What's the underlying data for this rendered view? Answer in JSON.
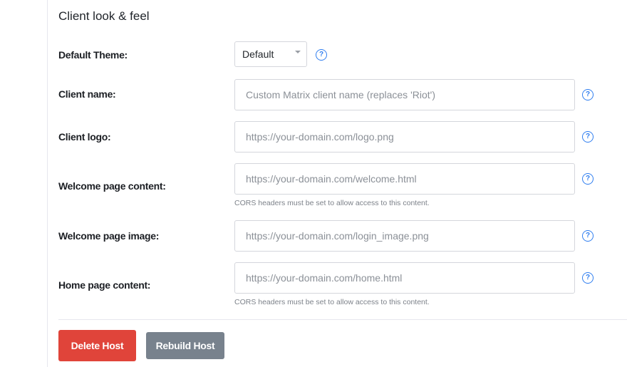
{
  "section": {
    "title": "Client look & feel"
  },
  "fields": {
    "theme": {
      "label": "Default Theme:",
      "selected": "Default",
      "help_icon": "question-circle-icon"
    },
    "client_name": {
      "label": "Client name:",
      "value": "",
      "placeholder": "Custom Matrix client name (replaces 'Riot')",
      "help_icon": "question-circle-icon"
    },
    "client_logo": {
      "label": "Client logo:",
      "value": "",
      "placeholder": "https://your-domain.com/logo.png",
      "help_icon": "question-circle-icon"
    },
    "welcome_content": {
      "label": "Welcome page content:",
      "value": "",
      "placeholder": "https://your-domain.com/welcome.html",
      "hint": "CORS headers must be set to allow access to this content.",
      "help_icon": "question-circle-icon"
    },
    "welcome_image": {
      "label": "Welcome page image:",
      "value": "",
      "placeholder": "https://your-domain.com/login_image.png",
      "help_icon": "question-circle-icon"
    },
    "home_content": {
      "label": "Home page content:",
      "value": "",
      "placeholder": "https://your-domain.com/home.html",
      "hint": "CORS headers must be set to allow access to this content.",
      "help_icon": "question-circle-icon"
    }
  },
  "help_glyph": "?",
  "actions": {
    "delete_label": "Delete Host",
    "rebuild_label": "Rebuild Host"
  },
  "colors": {
    "danger": "#e0443a",
    "secondary": "#78828d",
    "help_accent": "#2f7ef0"
  }
}
